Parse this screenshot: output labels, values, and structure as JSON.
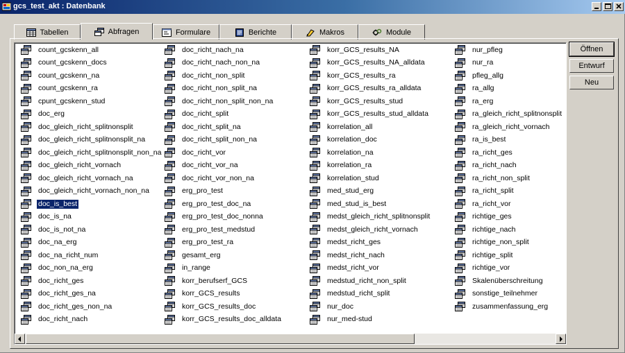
{
  "window": {
    "title": "gcs_test_akt : Datenbank",
    "colors": {
      "titlebar_start": "#0a246a",
      "titlebar_end": "#a6caf0",
      "selection": "#0a246a",
      "face": "#d4d0c8"
    }
  },
  "tabs": [
    {
      "label": "Tabellen",
      "icon": "table-icon"
    },
    {
      "label": "Abfragen",
      "icon": "query-icon",
      "active": true
    },
    {
      "label": "Formulare",
      "icon": "form-icon"
    },
    {
      "label": "Berichte",
      "icon": "report-icon"
    },
    {
      "label": "Makros",
      "icon": "macro-icon"
    },
    {
      "label": "Module",
      "icon": "module-icon"
    }
  ],
  "buttons": {
    "open": "Öffnen",
    "design": "Entwurf",
    "new": "Neu"
  },
  "selected_query": "doc_is_best",
  "queries": {
    "col1": [
      "count_gcskenn_all",
      "count_gcskenn_docs",
      "count_gcskenn_na",
      "count_gcskenn_ra",
      "cpunt_gcskenn_stud",
      "doc_erg",
      "doc_gleich_richt_splitnonsplit",
      "doc_gleich_richt_splitnonsplit_na",
      "doc_gleich_richt_splitnonsplit_non_na",
      "doc_gleich_richt_vornach",
      "doc_gleich_richt_vornach_na",
      "doc_gleich_richt_vornach_non_na",
      "doc_is_best",
      "doc_is_na",
      "doc_is_not_na",
      "doc_na_erg",
      "doc_na_richt_num",
      "doc_non_na_erg",
      "doc_richt_ges",
      "doc_richt_ges_na",
      "doc_richt_ges_non_na",
      "doc_richt_nach"
    ],
    "col2": [
      "doc_richt_nach_na",
      "doc_richt_nach_non_na",
      "doc_richt_non_split",
      "doc_richt_non_split_na",
      "doc_richt_non_split_non_na",
      "doc_richt_split",
      "doc_richt_split_na",
      "doc_richt_split_non_na",
      "doc_richt_vor",
      "doc_richt_vor_na",
      "doc_richt_vor_non_na",
      "erg_pro_test",
      "erg_pro_test_doc_na",
      "erg_pro_test_doc_nonna",
      "erg_pro_test_medstud",
      "erg_pro_test_ra",
      "gesamt_erg",
      "in_range",
      "korr_berufserf_GCS",
      "korr_GCS_results",
      "korr_GCS_results_doc",
      "korr_GCS_results_doc_alldata"
    ],
    "col3": [
      "korr_GCS_results_NA",
      "korr_GCS_results_NA_alldata",
      "korr_GCS_results_ra",
      "korr_GCS_results_ra_alldata",
      "korr_GCS_results_stud",
      "korr_GCS_results_stud_alldata",
      "korrelation_all",
      "korrelation_doc",
      "korrelation_na",
      "korrelation_ra",
      "korrelation_stud",
      "med_stud_erg",
      "med_stud_is_best",
      "medst_gleich_richt_splitnonsplit",
      "medst_gleich_richt_vornach",
      "medst_richt_ges",
      "medst_richt_nach",
      "medst_richt_vor",
      "medstud_richt_non_split",
      "medstud_richt_split",
      "nur_doc",
      "nur_med-stud"
    ],
    "col4": [
      "nur_pfleg",
      "nur_ra",
      "pfleg_allg",
      "ra_allg",
      "ra_erg",
      "ra_gleich_richt_splitnonsplit",
      "ra_gleich_richt_vornach",
      "ra_is_best",
      "ra_richt_ges",
      "ra_richt_nach",
      "ra_richt_non_split",
      "ra_richt_split",
      "ra_richt_vor",
      "richtige_ges",
      "richtige_nach",
      "richtige_non_split",
      "richtige_split",
      "richtige_vor",
      "Skalenüberschreitung",
      "sonstige_teilnehmer",
      "zusammenfassung_erg"
    ]
  }
}
